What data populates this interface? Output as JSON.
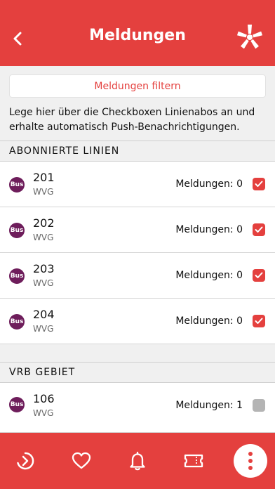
{
  "header": {
    "title": "Meldungen"
  },
  "filter": {
    "label": "Meldungen filtern"
  },
  "info_text": "Lege hier über die Checkboxen Linienabos an und erhalte automatisch Push-Benachrichtigungen.",
  "sections": [
    {
      "title": "ABONNIERTE LINIEN",
      "lines": [
        {
          "badge": "Bus",
          "number": "201",
          "operator": "WVG",
          "messages": "Meldungen: 0",
          "checked": true
        },
        {
          "badge": "Bus",
          "number": "202",
          "operator": "WVG",
          "messages": "Meldungen: 0",
          "checked": true
        },
        {
          "badge": "Bus",
          "number": "203",
          "operator": "WVG",
          "messages": "Meldungen: 0",
          "checked": true
        },
        {
          "badge": "Bus",
          "number": "204",
          "operator": "WVG",
          "messages": "Meldungen: 0",
          "checked": true
        }
      ]
    },
    {
      "title": "VRB GEBIET",
      "lines": [
        {
          "badge": "Bus",
          "number": "106",
          "operator": "WVG",
          "messages": "Meldungen: 1",
          "checked": false
        }
      ]
    }
  ],
  "tabbar": {
    "items": [
      "route-icon",
      "heart-icon",
      "bell-icon",
      "ticket-icon",
      "more-icon"
    ]
  },
  "colors": {
    "brand": "#e4403e",
    "bus_badge": "#6e1d5b",
    "unchecked": "#b4b4b4"
  }
}
